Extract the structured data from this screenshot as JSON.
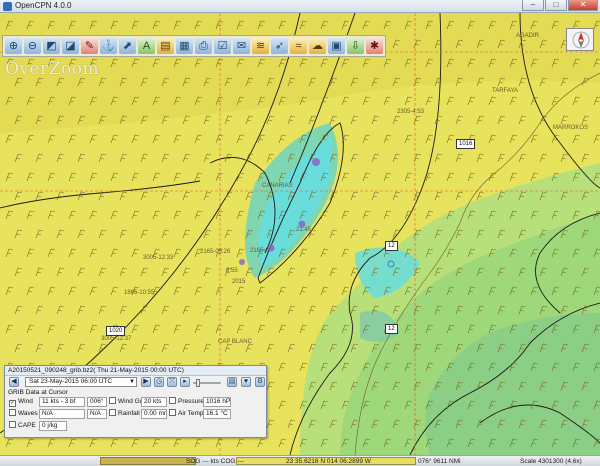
{
  "window": {
    "title": "OpenCPN 4.0.0",
    "btn_min": "–",
    "btn_max": "□",
    "btn_close": "✕"
  },
  "toolbar": [
    {
      "name": "zoom-in-icon",
      "glyph": "⊕",
      "style": "blue"
    },
    {
      "name": "zoom-out-icon",
      "glyph": "⊖",
      "style": "blue"
    },
    {
      "name": "scale-in-icon",
      "glyph": "◩",
      "style": "blue"
    },
    {
      "name": "scale-out-icon",
      "glyph": "◪",
      "style": "blue"
    },
    {
      "name": "route-icon",
      "glyph": "✎",
      "style": "red"
    },
    {
      "name": "auto-follow-icon",
      "glyph": "⚓",
      "style": "blue"
    },
    {
      "name": "track-icon",
      "glyph": "⬈",
      "style": "blue"
    },
    {
      "name": "text-icon",
      "glyph": "A",
      "style": "green"
    },
    {
      "name": "quilt-icon",
      "glyph": "▤",
      "style": "gold"
    },
    {
      "name": "chart-bar-icon",
      "glyph": "▦",
      "style": "blue"
    },
    {
      "name": "print-icon",
      "glyph": "⎙",
      "style": "blue"
    },
    {
      "name": "route-manager-icon",
      "glyph": "☑",
      "style": "blue"
    },
    {
      "name": "settings-icon",
      "glyph": "✉",
      "style": "blue"
    },
    {
      "name": "tide-icon",
      "glyph": "≋",
      "style": "gold"
    },
    {
      "name": "current-icon",
      "glyph": "➶",
      "style": "blue"
    },
    {
      "name": "grib-icon",
      "glyph": "≈",
      "style": "gold"
    },
    {
      "name": "cloud-icon",
      "glyph": "☁",
      "style": "gold"
    },
    {
      "name": "ais-icon",
      "glyph": "▣",
      "style": "blue"
    },
    {
      "name": "download-icon",
      "glyph": "⇩",
      "style": "green"
    },
    {
      "name": "help-icon",
      "glyph": "✱",
      "style": "red"
    }
  ],
  "overzoom": "OverZoom",
  "map_labels": [
    {
      "text": "AGADIR"
    },
    {
      "text": "TARFAYA"
    },
    {
      "text": "MARROKOS"
    },
    {
      "text": "CANARIAS"
    },
    {
      "text": "CAP BLANC"
    },
    {
      "text": "2305-4:53"
    },
    {
      "text": "3005-12:33"
    },
    {
      "text": "2165-05:26"
    },
    {
      "text": "2165-0"
    },
    {
      "text": "1865-10:55"
    },
    {
      "text": "3005-12:37"
    },
    {
      "text": "21:45"
    },
    {
      "text": "0:55"
    },
    {
      "text": "2015"
    }
  ],
  "route_boxes": [
    {
      "text": "1016"
    },
    {
      "text": "12"
    },
    {
      "text": "12"
    },
    {
      "text": "1020"
    }
  ],
  "grib": {
    "title": "A20150521_090248_grib.bz2( Thu 21-May-2015 00:00  UTC)",
    "datetime": "Sat 23-May-2015 06:00  UTC",
    "subtitle": "GRIB Data at Cursor",
    "wind_label": "Wind",
    "wind_value": "11 kts - 3 bf",
    "wind_dir": "006°",
    "wind_gust_label": "Wind Gust",
    "wind_gust_value": "20 kts",
    "pressure_label": "Pressure",
    "pressure_value": "1016 hPa",
    "waves_label": "Waves",
    "waves_value": "N/A",
    "waves_dir": "N/A",
    "rainfall_label": "Rainfall",
    "rainfall_value": "0.00 mm",
    "airtemp_label": "Air Temp",
    "airtemp_value": "16.1 °C",
    "cape_label": "CAPE",
    "cape_value": "0 j/kg"
  },
  "status": {
    "sog": "SOG --- kts COG ---",
    "position": "23 35.6216 N   014 06.2899 W",
    "bearing": "076°  9611 NMi",
    "scale": "Scale 4301300 (4.6x)"
  },
  "colors": {
    "map_yellow": "#e8e35c",
    "map_green": "#9ed87a",
    "map_cyan": "#69dcdc",
    "map_teal": "#7fc8a8",
    "wind_barb": "#7a6a1e",
    "grid_line": "#e0543a"
  }
}
